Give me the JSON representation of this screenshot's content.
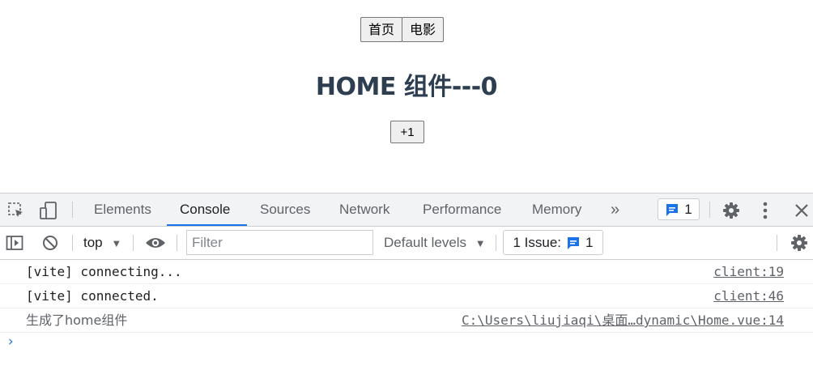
{
  "app": {
    "nav": [
      "首页",
      "电影"
    ],
    "heading": "HOME 组件---0",
    "increment_label": "+1"
  },
  "devtools": {
    "tabs": [
      "Elements",
      "Console",
      "Sources",
      "Network",
      "Performance",
      "Memory"
    ],
    "active_tab": "Console",
    "more_tabs_icon": "»",
    "message_count": "1",
    "context": "top",
    "filter_placeholder": "Filter",
    "levels": "Default levels",
    "issues": {
      "label": "1 Issue:",
      "count": "1"
    },
    "console": [
      {
        "text": "[vite] connecting...",
        "source": "client:19"
      },
      {
        "text": "[vite] connected.",
        "source": "client:46"
      },
      {
        "text": "生成了home组件",
        "source": "C:\\Users\\liujiaqi\\桌面…dynamic\\Home.vue:14"
      }
    ],
    "prompt_icon": "›"
  },
  "colors": {
    "accent": "#1a73e8",
    "heading": "#2c3e50",
    "panel": "#f1f3f4"
  },
  "icons": [
    "inspect-element-icon",
    "device-toggle-icon",
    "more-tabs-icon",
    "message-icon",
    "settings-gear-icon",
    "kebab-menu-icon",
    "close-icon",
    "sidebar-toggle-icon",
    "clear-console-icon",
    "dropdown-arrow-icon",
    "eye-icon",
    "prompt-chevron-icon"
  ]
}
